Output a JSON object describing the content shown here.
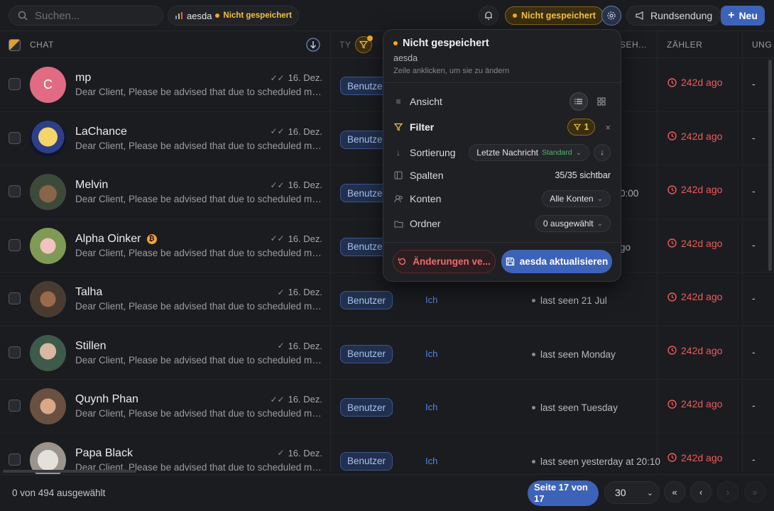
{
  "header": {
    "search_placeholder": "Suchen...",
    "view_name": "aesda",
    "view_unsaved": "Nicht gespeichert",
    "unsaved_pill": "Nicht gespeichert",
    "broadcast_label": "Rundsendung",
    "new_label": "Neu"
  },
  "columns": {
    "chat": "CHAT",
    "type_partial": "TY",
    "seen_partial": "SEH...",
    "counter": "ZÄHLER",
    "last_partial": "UNG"
  },
  "rows": [
    {
      "name": "mp",
      "initial": "C",
      "preview": "Dear Client, Please be advised that due to scheduled maintenance",
      "date": "16. Dez.",
      "check": "✓✓",
      "type": "Benutzer",
      "owner": "",
      "seen": "",
      "counter": "242d ago",
      "dash": "-"
    },
    {
      "name": "LaChance",
      "preview": "Dear Client, Please be advised that due to scheduled maintenance",
      "date": "16. Dez.",
      "check": "✓✓",
      "type": "Benutzer",
      "owner": "",
      "seen": "",
      "counter": "242d ago",
      "dash": "-"
    },
    {
      "name": "Melvin",
      "preview": "Dear Client, Please be advised that due to scheduled maintenance",
      "date": "16. Dez.",
      "check": "✓✓",
      "type": "Benutzer",
      "owner": "",
      "seen": "0:00",
      "counter": "242d ago",
      "dash": "-"
    },
    {
      "name": "Alpha Oinker",
      "preview": "Dear Client, Please be advised that due to scheduled maintenance",
      "date": "16. Dez.",
      "check": "✓✓",
      "type": "Benutzer",
      "owner": "",
      "seen": "go",
      "counter": "242d ago",
      "dash": "-"
    },
    {
      "name": "Talha",
      "preview": "Dear Client, Please be advised that due to scheduled maintenance",
      "date": "16. Dez.",
      "check": "✓",
      "type": "Benutzer",
      "owner": "Ich",
      "seen": "last seen 21 Jul",
      "counter": "242d ago",
      "dash": "-"
    },
    {
      "name": "Stillen",
      "preview": "Dear Client, Please be advised that due to scheduled maintenance",
      "date": "16. Dez.",
      "check": "✓",
      "type": "Benutzer",
      "owner": "Ich",
      "seen": "last seen Monday",
      "counter": "242d ago",
      "dash": "-"
    },
    {
      "name": "Quynh Phan",
      "preview": "Dear Client, Please be advised that due to scheduled maintenance",
      "date": "16. Dez.",
      "check": "✓✓",
      "type": "Benutzer",
      "owner": "Ich",
      "seen": "last seen Tuesday",
      "counter": "242d ago",
      "dash": "-"
    },
    {
      "name": "Papa Black",
      "preview": "Dear Client, Please be advised that due to scheduled maintenance",
      "date": "16. Dez.",
      "check": "✓",
      "type": "Benutzer",
      "owner": "Ich",
      "seen": "last seen yesterday at 20:10",
      "counter": "242d ago",
      "dash": "-"
    }
  ],
  "footer": {
    "selected": "0 von 494 ausgewählt",
    "page": "Seite 17 von 17",
    "per_page": "30"
  },
  "popover": {
    "title": "Nicht gespeichert",
    "view_name": "aesda",
    "hint": "Zeile anklicken, um sie zu ändern",
    "view_label": "Ansicht",
    "filter_label": "Filter",
    "filter_count": "1",
    "sort_label": "Sortierung",
    "sort_value": "Letzte Nachricht",
    "sort_default": "Standard",
    "columns_label": "Spalten",
    "columns_value": "35/35 sichtbar",
    "accounts_label": "Konten",
    "accounts_value": "Alle Konten",
    "folder_label": "Ordner",
    "folder_value": "0 ausgewählt",
    "reset_label": "Änderungen ve...",
    "update_label": "aesda aktualisieren"
  },
  "colors": {
    "accent": "#3d63b8",
    "warning": "#f5c242",
    "danger": "#ef5a5a",
    "link": "#4f86e8"
  }
}
